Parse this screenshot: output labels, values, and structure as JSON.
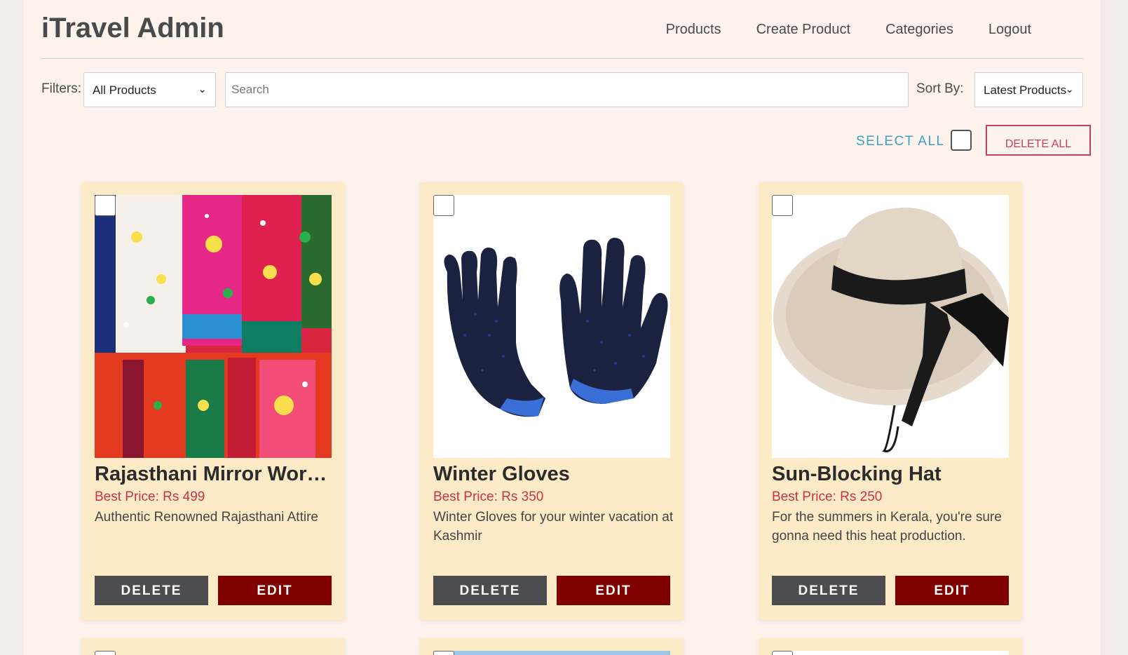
{
  "header": {
    "brand": "iTravel Admin",
    "nav": [
      "Products",
      "Create Product",
      "Categories",
      "Logout"
    ]
  },
  "filters": {
    "label": "Filters:",
    "selected": "All Products",
    "search_placeholder": "Search",
    "sort_label": "Sort By:",
    "sort_selected": "Latest Products"
  },
  "bulk": {
    "select_all": "SELECT ALL",
    "delete_all": "DELETE ALL"
  },
  "products": [
    {
      "title": "Rajasthani Mirror Work Fabric",
      "price": "Best Price: Rs 499",
      "desc": "Authentic Renowned Rajasthani Attire",
      "image": "embroidered-fabric"
    },
    {
      "title": "Winter Gloves",
      "price": "Best Price: Rs 350",
      "desc": "Winter Gloves for your winter vacation at Kashmir",
      "image": "gloves"
    },
    {
      "title": "Sun-Blocking Hat",
      "price": "Best Price: Rs 250",
      "desc": "For the summers in Kerala, you're sure gonna need this heat production.",
      "image": "straw-hat"
    }
  ],
  "buttons": {
    "delete": "DELETE",
    "edit": "EDIT"
  },
  "colors": {
    "page_bg": "#fef2ec",
    "card_bg": "#fdebc8",
    "price": "#c9314a",
    "edit_btn": "#800000",
    "delete_btn": "#4d4d4f",
    "select_all": "#3aa0c4"
  }
}
